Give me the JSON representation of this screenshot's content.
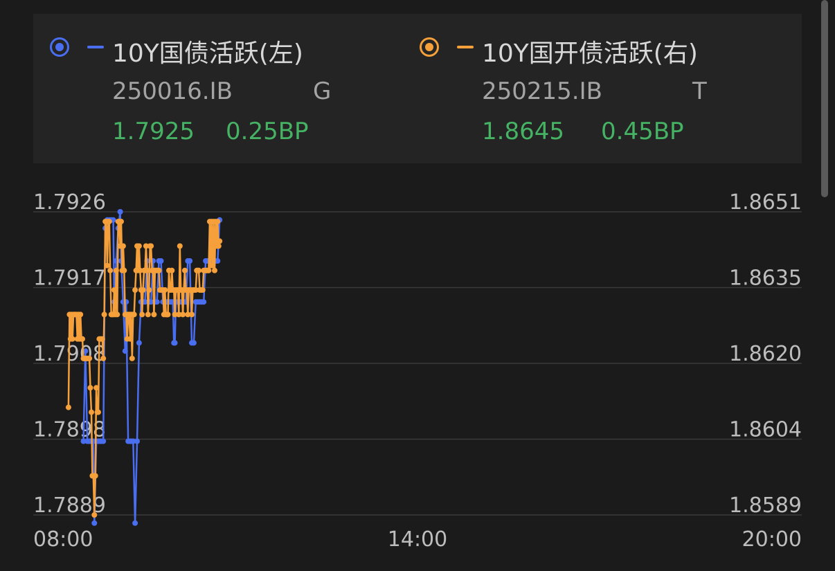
{
  "colors": {
    "background": "#1b1b1b",
    "panel": "#242424",
    "series_blue": "#4a6ef0",
    "series_orange": "#f5a03a",
    "positive_green": "#45b264",
    "gridline": "#3a3a3a",
    "axis_text": "#bdbdbd"
  },
  "legend": {
    "series": [
      {
        "name": "10Y国债活跃(左)",
        "code": "250016.IB",
        "market": "G",
        "yield": "1.7925",
        "change": "0.25BP",
        "color": "#4a6ef0"
      },
      {
        "name": "10Y国开债活跃(右)",
        "code": "250215.IB",
        "market": "T",
        "yield": "1.8645",
        "change": "0.45BP",
        "color": "#f5a03a"
      }
    ]
  },
  "chart_data": {
    "type": "line",
    "x_ticks": [
      "08:00",
      "14:00",
      "20:00"
    ],
    "x_range_minutes": [
      480,
      1200
    ],
    "y_left_ticks": [
      "1.7926",
      "1.7917",
      "1.7908",
      "1.7898",
      "1.7889"
    ],
    "y_left_range": [
      1.7889,
      1.7926
    ],
    "y_right_ticks": [
      "1.8651",
      "1.8635",
      "1.8620",
      "1.8604",
      "1.8589"
    ],
    "y_right_range": [
      1.8589,
      1.8651
    ],
    "grid": true,
    "series": [
      {
        "name": "10Y国债活跃(左)",
        "axis": "left",
        "color": "#4a6ef0",
        "points": [
          [
            "08:24",
            1.7898
          ],
          [
            "08:26",
            1.7909
          ],
          [
            "08:28",
            1.7898
          ],
          [
            "08:30",
            1.7898
          ],
          [
            "08:32",
            1.7898
          ],
          [
            "08:34",
            1.7898
          ],
          [
            "08:35",
            1.7888
          ],
          [
            "08:37",
            1.7898
          ],
          [
            "08:39",
            1.7898
          ],
          [
            "08:41",
            1.7898
          ],
          [
            "08:42",
            1.7898
          ],
          [
            "08:44",
            1.7898
          ],
          [
            "08:46",
            1.7924
          ],
          [
            "08:48",
            1.7925
          ],
          [
            "08:50",
            1.7925
          ],
          [
            "08:52",
            1.7925
          ],
          [
            "08:54",
            1.7925
          ],
          [
            "08:55",
            1.7915
          ],
          [
            "08:57",
            1.792
          ],
          [
            "08:59",
            1.7924
          ],
          [
            "09:01",
            1.7926
          ],
          [
            "09:02",
            1.792
          ],
          [
            "09:04",
            1.7915
          ],
          [
            "09:06",
            1.7909
          ],
          [
            "09:07",
            1.7915
          ],
          [
            "09:09",
            1.7898
          ],
          [
            "09:11",
            1.7898
          ],
          [
            "09:12",
            1.7898
          ],
          [
            "09:14",
            1.7898
          ],
          [
            "09:16",
            1.7888
          ],
          [
            "09:18",
            1.7898
          ],
          [
            "09:20",
            1.791
          ],
          [
            "09:22",
            1.7915
          ],
          [
            "09:24",
            1.7915
          ],
          [
            "09:26",
            1.7915
          ],
          [
            "09:28",
            1.792
          ],
          [
            "09:30",
            1.7915
          ],
          [
            "09:32",
            1.7915
          ],
          [
            "09:34",
            1.792
          ],
          [
            "09:36",
            1.7915
          ],
          [
            "09:38",
            1.7915
          ],
          [
            "09:40",
            1.792
          ],
          [
            "09:42",
            1.792
          ],
          [
            "09:44",
            1.7915
          ],
          [
            "09:46",
            1.7915
          ],
          [
            "09:48",
            1.7915
          ],
          [
            "09:50",
            1.7915
          ],
          [
            "09:52",
            1.7915
          ],
          [
            "09:54",
            1.7915
          ],
          [
            "09:55",
            1.791
          ],
          [
            "09:56",
            1.791
          ],
          [
            "09:57",
            1.7915
          ],
          [
            "09:59",
            1.7915
          ],
          [
            "10:01",
            1.7915
          ],
          [
            "10:03",
            1.7915
          ],
          [
            "10:05",
            1.7915
          ],
          [
            "10:07",
            1.7915
          ],
          [
            "10:09",
            1.792
          ],
          [
            "10:11",
            1.792
          ],
          [
            "10:13",
            1.791
          ],
          [
            "10:15",
            1.791
          ],
          [
            "10:17",
            1.7915
          ],
          [
            "10:19",
            1.7915
          ],
          [
            "10:21",
            1.7915
          ],
          [
            "10:23",
            1.7915
          ],
          [
            "10:25",
            1.7915
          ],
          [
            "10:27",
            1.792
          ],
          [
            "10:29",
            1.792
          ],
          [
            "10:31",
            1.792
          ],
          [
            "10:33",
            1.792
          ],
          [
            "10:35",
            1.792
          ],
          [
            "10:37",
            1.792
          ],
          [
            "10:39",
            1.792
          ],
          [
            "10:41",
            1.7925
          ]
        ]
      },
      {
        "name": "10Y国开债活跃(右)",
        "axis": "right",
        "color": "#f5a03a",
        "points": [
          [
            "08:09",
            1.8611
          ],
          [
            "08:10",
            1.863
          ],
          [
            "08:11",
            1.8625
          ],
          [
            "08:12",
            1.863
          ],
          [
            "08:13",
            1.8625
          ],
          [
            "08:14",
            1.863
          ],
          [
            "08:15",
            1.863
          ],
          [
            "08:16",
            1.863
          ],
          [
            "08:17",
            1.863
          ],
          [
            "08:18",
            1.8625
          ],
          [
            "08:19",
            1.863
          ],
          [
            "08:20",
            1.8625
          ],
          [
            "08:21",
            1.863
          ],
          [
            "08:22",
            1.8625
          ],
          [
            "08:23",
            1.8625
          ],
          [
            "08:24",
            1.8621
          ],
          [
            "08:25",
            1.8621
          ],
          [
            "08:26",
            1.8621
          ],
          [
            "08:27",
            1.8621
          ],
          [
            "08:28",
            1.8621
          ],
          [
            "08:29",
            1.8621
          ],
          [
            "08:30",
            1.8621
          ],
          [
            "08:31",
            1.8615
          ],
          [
            "08:32",
            1.861
          ],
          [
            "08:33",
            1.8597
          ],
          [
            "08:34",
            1.8597
          ],
          [
            "08:35",
            1.8589
          ],
          [
            "08:36",
            1.8597
          ],
          [
            "08:37",
            1.8615
          ],
          [
            "08:38",
            1.861
          ],
          [
            "08:39",
            1.861
          ],
          [
            "08:40",
            1.8625
          ],
          [
            "08:41",
            1.8625
          ],
          [
            "08:42",
            1.8625
          ],
          [
            "08:43",
            1.8625
          ],
          [
            "08:44",
            1.8621
          ],
          [
            "08:45",
            1.863
          ],
          [
            "08:46",
            1.8649
          ],
          [
            "08:47",
            1.8649
          ],
          [
            "08:48",
            1.864
          ],
          [
            "08:49",
            1.8649
          ],
          [
            "08:50",
            1.8649
          ],
          [
            "08:51",
            1.8639
          ],
          [
            "08:52",
            1.863
          ],
          [
            "08:53",
            1.863
          ],
          [
            "08:54",
            1.863
          ],
          [
            "08:55",
            1.8635
          ],
          [
            "08:56",
            1.863
          ],
          [
            "08:57",
            1.8639
          ],
          [
            "08:58",
            1.863
          ],
          [
            "08:59",
            1.8649
          ],
          [
            "09:00",
            1.8649
          ],
          [
            "09:01",
            1.8644
          ],
          [
            "09:02",
            1.8649
          ],
          [
            "09:03",
            1.8639
          ],
          [
            "09:04",
            1.8644
          ],
          [
            "09:05",
            1.8639
          ],
          [
            "09:06",
            1.863
          ],
          [
            "09:07",
            1.863
          ],
          [
            "09:08",
            1.8625
          ],
          [
            "09:09",
            1.863
          ],
          [
            "09:10",
            1.863
          ],
          [
            "09:11",
            1.8625
          ],
          [
            "09:12",
            1.863
          ],
          [
            "09:13",
            1.8621
          ],
          [
            "09:14",
            1.863
          ],
          [
            "09:15",
            1.863
          ],
          [
            "09:16",
            1.8635
          ],
          [
            "09:17",
            1.8639
          ],
          [
            "09:18",
            1.8644
          ],
          [
            "09:19",
            1.8639
          ],
          [
            "09:20",
            1.8644
          ],
          [
            "09:21",
            1.8639
          ],
          [
            "09:22",
            1.8635
          ],
          [
            "09:23",
            1.863
          ],
          [
            "09:24",
            1.8635
          ],
          [
            "09:25",
            1.8639
          ],
          [
            "09:26",
            1.8639
          ],
          [
            "09:27",
            1.8644
          ],
          [
            "09:28",
            1.8639
          ],
          [
            "09:29",
            1.863
          ],
          [
            "09:30",
            1.8635
          ],
          [
            "09:31",
            1.8644
          ],
          [
            "09:32",
            1.8644
          ],
          [
            "09:33",
            1.8639
          ],
          [
            "09:34",
            1.8639
          ],
          [
            "09:35",
            1.863
          ],
          [
            "09:36",
            1.8639
          ],
          [
            "09:37",
            1.8639
          ],
          [
            "09:38",
            1.8639
          ],
          [
            "09:39",
            1.8639
          ],
          [
            "09:40",
            1.8639
          ],
          [
            "09:41",
            1.8635
          ],
          [
            "09:42",
            1.8635
          ],
          [
            "09:43",
            1.8635
          ],
          [
            "09:44",
            1.8635
          ],
          [
            "09:45",
            1.863
          ],
          [
            "09:46",
            1.8635
          ],
          [
            "09:47",
            1.863
          ],
          [
            "09:48",
            1.863
          ],
          [
            "09:49",
            1.863
          ],
          [
            "09:50",
            1.8639
          ],
          [
            "09:51",
            1.8635
          ],
          [
            "09:52",
            1.8635
          ],
          [
            "09:53",
            1.8639
          ],
          [
            "09:54",
            1.8635
          ],
          [
            "09:55",
            1.8635
          ],
          [
            "09:56",
            1.863
          ],
          [
            "09:57",
            1.8635
          ],
          [
            "09:58",
            1.8635
          ],
          [
            "09:59",
            1.8635
          ],
          [
            "10:00",
            1.863
          ],
          [
            "10:01",
            1.8644
          ],
          [
            "10:02",
            1.8635
          ],
          [
            "10:03",
            1.8635
          ],
          [
            "10:04",
            1.863
          ],
          [
            "10:05",
            1.8635
          ],
          [
            "10:06",
            1.8639
          ],
          [
            "10:07",
            1.8635
          ],
          [
            "10:08",
            1.8635
          ],
          [
            "10:09",
            1.863
          ],
          [
            "10:10",
            1.8635
          ],
          [
            "10:11",
            1.8635
          ],
          [
            "10:12",
            1.8635
          ],
          [
            "10:13",
            1.863
          ],
          [
            "10:14",
            1.8635
          ],
          [
            "10:15",
            1.8635
          ],
          [
            "10:16",
            1.8635
          ],
          [
            "10:17",
            1.8635
          ],
          [
            "10:18",
            1.8639
          ],
          [
            "10:19",
            1.8639
          ],
          [
            "10:20",
            1.8639
          ],
          [
            "10:21",
            1.8635
          ],
          [
            "10:22",
            1.8635
          ],
          [
            "10:23",
            1.8635
          ],
          [
            "10:24",
            1.8635
          ],
          [
            "10:25",
            1.8639
          ],
          [
            "10:26",
            1.8639
          ],
          [
            "10:27",
            1.8639
          ],
          [
            "10:28",
            1.8639
          ],
          [
            "10:29",
            1.8639
          ],
          [
            "10:30",
            1.8639
          ],
          [
            "10:31",
            1.8649
          ],
          [
            "10:32",
            1.864
          ],
          [
            "10:33",
            1.8649
          ],
          [
            "10:34",
            1.864
          ],
          [
            "10:35",
            1.8649
          ],
          [
            "10:36",
            1.8639
          ],
          [
            "10:37",
            1.8649
          ],
          [
            "10:38",
            1.8644
          ],
          [
            "10:39",
            1.8649
          ],
          [
            "10:40",
            1.8644
          ],
          [
            "10:41",
            1.8645
          ]
        ]
      }
    ]
  }
}
